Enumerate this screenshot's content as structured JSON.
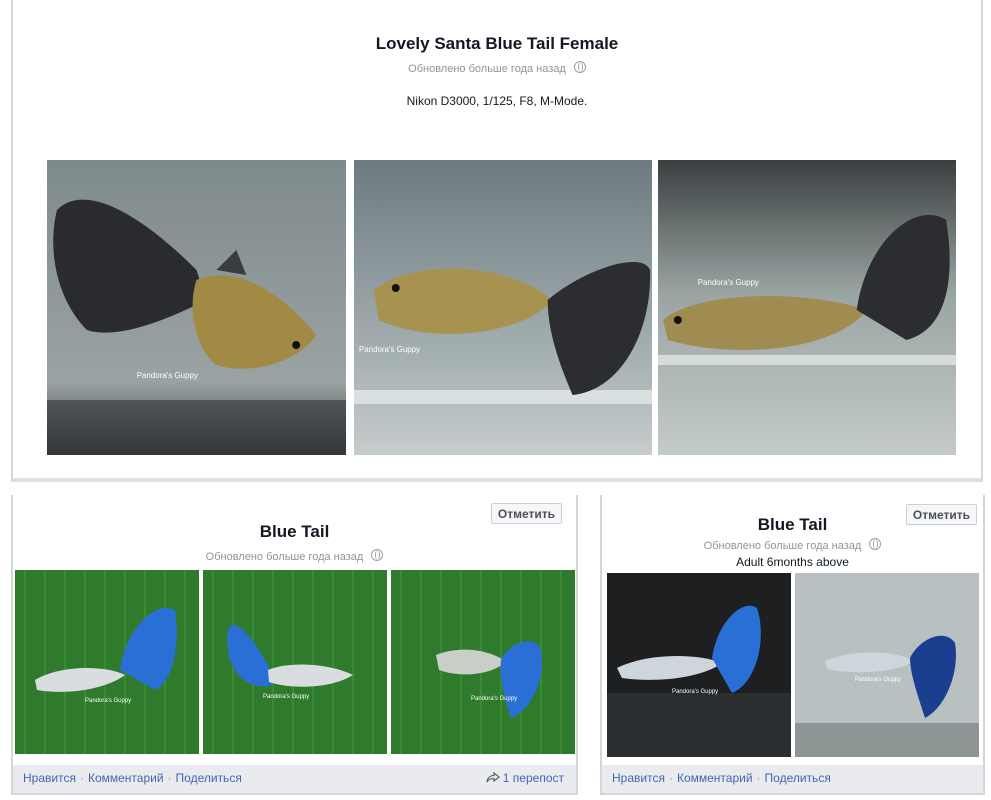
{
  "albums": {
    "top": {
      "title": "Lovely Santa Blue Tail Female",
      "updated": "Обновлено больше года назад",
      "description": "Nikon D3000, 1/125, F8, M-Mode.",
      "photos": [
        {
          "alt": "guppy-photo-1",
          "watermark": "Pandora's Guppy"
        },
        {
          "alt": "guppy-photo-2",
          "watermark": "Pandora's Guppy"
        },
        {
          "alt": "guppy-photo-3",
          "watermark": "Pandora's Guppy"
        }
      ]
    },
    "left": {
      "title": "Blue Tail",
      "updated": "Обновлено больше года назад",
      "mark_label": "Отметить",
      "photos": [
        {
          "alt": "blue-guppy-1",
          "watermark": "Pandora's Guppy"
        },
        {
          "alt": "blue-guppy-2",
          "watermark": "Pandora's Guppy"
        },
        {
          "alt": "blue-guppy-3",
          "watermark": "Pandora's Guppy"
        }
      ],
      "actions": {
        "like": "Нравится",
        "comment": "Комментарий",
        "share": "Поделиться"
      },
      "shares_label": "1 перепост"
    },
    "right": {
      "title": "Blue Tail",
      "updated": "Обновлено больше года назад",
      "description": "Adult 6months above",
      "mark_label": "Отметить",
      "photos": [
        {
          "alt": "blue-guppy-4",
          "watermark": "Pandora's Guppy"
        },
        {
          "alt": "blue-guppy-5",
          "watermark": "Pandora's Guppy"
        }
      ],
      "actions": {
        "like": "Нравится",
        "comment": "Комментарий",
        "share": "Поделиться"
      }
    }
  },
  "icons": {
    "globe": "globe-icon",
    "share": "share-arrow-icon"
  },
  "colors": {
    "link": "#4267b2",
    "muted": "#90949c",
    "footer_bg": "#e9ebee",
    "blue_fish": "#2a6fd6",
    "yellow_fish": "#b59a4a"
  }
}
